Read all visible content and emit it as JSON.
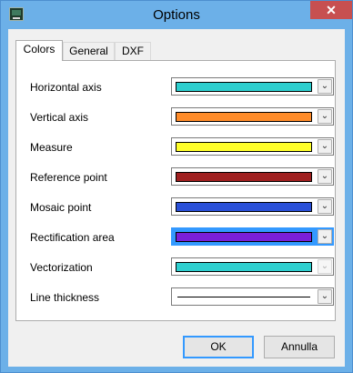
{
  "window": {
    "title": "Options",
    "close_label": "✕"
  },
  "tabs": [
    {
      "label": "Colors",
      "active": true
    },
    {
      "label": "General",
      "active": false
    },
    {
      "label": "DXF",
      "active": false
    }
  ],
  "rows": [
    {
      "label": "Horizontal axis",
      "color": "#2ecfcf",
      "focused": false,
      "disabled": false
    },
    {
      "label": "Vertical axis",
      "color": "#ff8c2a",
      "focused": false,
      "disabled": false
    },
    {
      "label": "Measure",
      "color": "#ffff2a",
      "focused": false,
      "disabled": false
    },
    {
      "label": "Reference point",
      "color": "#a02020",
      "focused": false,
      "disabled": false
    },
    {
      "label": "Mosaic point",
      "color": "#2a50d8",
      "focused": false,
      "disabled": false
    },
    {
      "label": "Rectification area",
      "color": "#7a1fd8",
      "focused": true,
      "disabled": false
    },
    {
      "label": "Vectorization",
      "color": "#2ecfcf",
      "focused": false,
      "disabled": true
    },
    {
      "label": "Line thickness",
      "line_sample": true,
      "focused": false,
      "disabled": false
    }
  ],
  "buttons": {
    "ok_label": "OK",
    "cancel_label": "Annulla"
  },
  "colors": {
    "titlebar": "#6cb0e8",
    "close_button": "#c75050",
    "focus": "#3399ff"
  },
  "icons": {
    "dropdown_arrow": "chevron-down-icon",
    "app": "app-icon"
  }
}
